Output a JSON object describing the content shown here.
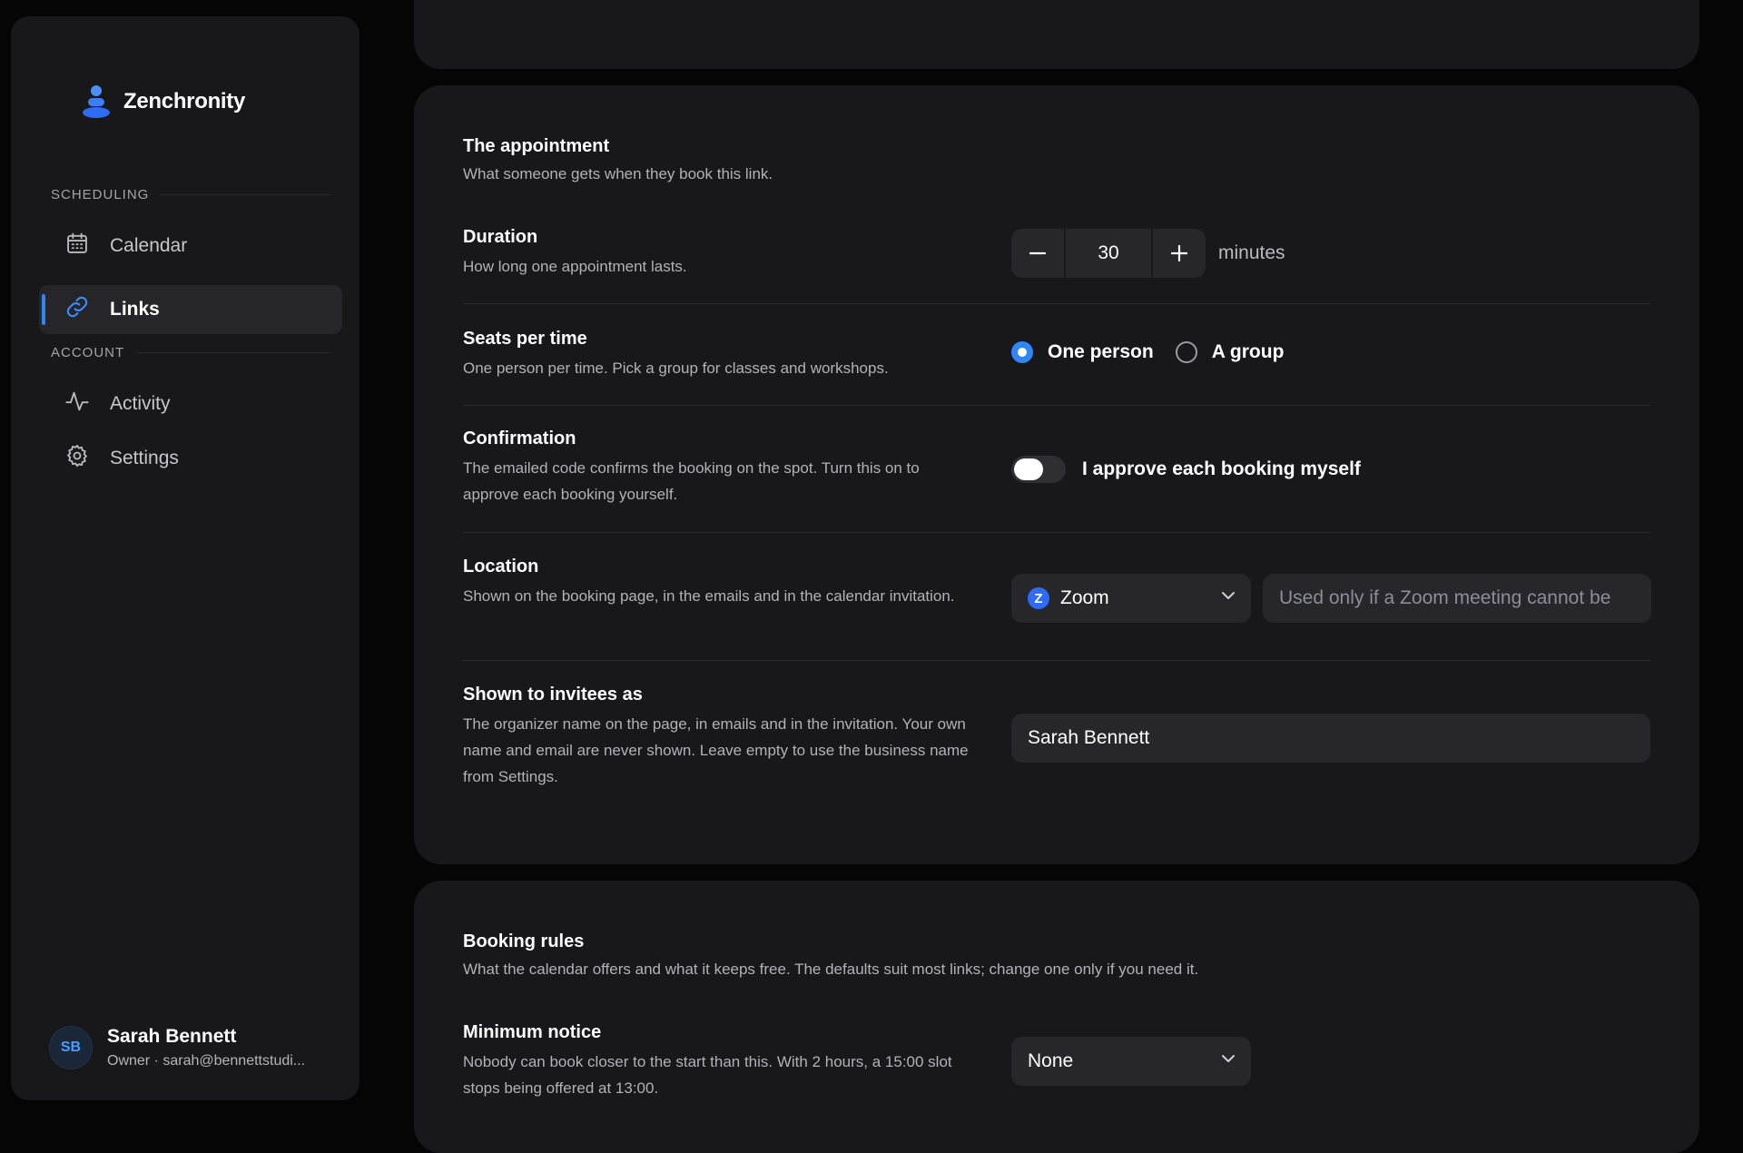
{
  "brand": {
    "name": "Zenchronity"
  },
  "sidebar": {
    "sections": [
      {
        "label": "SCHEDULING"
      },
      {
        "label": "ACCOUNT"
      }
    ],
    "items": [
      {
        "label": "Calendar",
        "icon": "calendar-icon"
      },
      {
        "label": "Links",
        "icon": "link-icon",
        "active": true
      },
      {
        "label": "Activity",
        "icon": "activity-icon"
      },
      {
        "label": "Settings",
        "icon": "gear-icon"
      }
    ],
    "user": {
      "initials": "SB",
      "name": "Sarah Bennett",
      "subtitle": "Owner · sarah@bennettstudi..."
    }
  },
  "appointment": {
    "title": "The appointment",
    "description": "What someone gets when they book this link.",
    "duration": {
      "title": "Duration",
      "description": "How long one appointment lasts.",
      "value": "30",
      "unit": "minutes"
    },
    "seats": {
      "title": "Seats per time",
      "description": "One person per time. Pick a group for classes and workshops.",
      "options": [
        "One person",
        "A group"
      ],
      "selected": "One person"
    },
    "confirmation": {
      "title": "Confirmation",
      "description": "The emailed code confirms the booking on the spot. Turn this on to approve each booking yourself.",
      "toggle_label": "I approve each booking myself",
      "enabled": false
    },
    "location": {
      "title": "Location",
      "description": "Shown on the booking page, in the emails and in the calendar invitation.",
      "selected": "Zoom",
      "fallback_placeholder": "Used only if a Zoom meeting cannot be"
    },
    "shown_as": {
      "title": "Shown to invitees as",
      "description": "The organizer name on the page, in emails and in the invitation. Your own name and email are never shown. Leave empty to use the business name from Settings.",
      "value": "Sarah Bennett"
    }
  },
  "booking_rules": {
    "title": "Booking rules",
    "description": "What the calendar offers and what it keeps free. The defaults suit most links; change one only if you need it.",
    "min_notice": {
      "title": "Minimum notice",
      "description": "Nobody can book closer to the start than this. With 2 hours, a 15:00 slot stops being offered at 13:00.",
      "selected": "None"
    }
  },
  "colors": {
    "accent": "#2f86f6",
    "card": "#18181b",
    "field": "#27272b"
  }
}
